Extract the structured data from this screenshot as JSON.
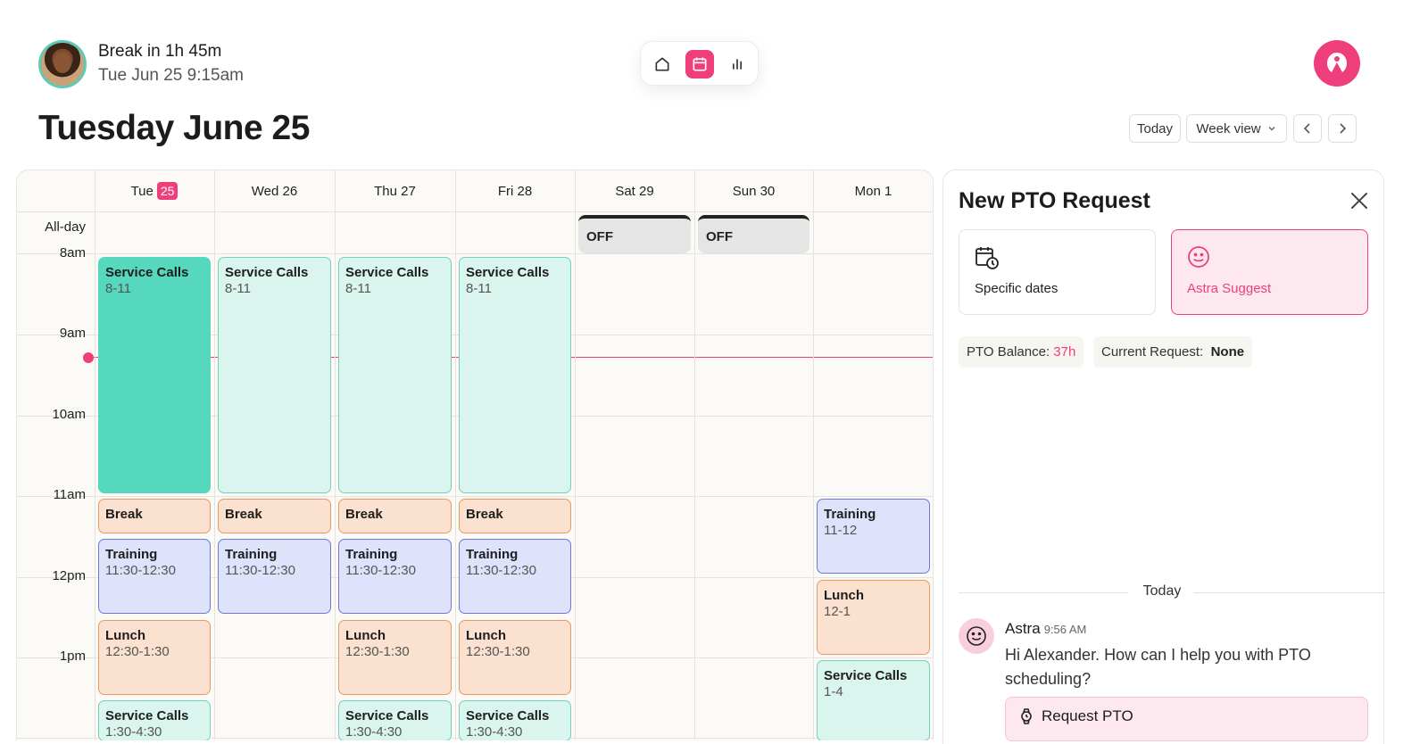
{
  "header": {
    "break_title": "Break in 1h 45m",
    "break_datetime": "Tue Jun 25 9:15am",
    "nav": {
      "home_icon": "home-icon",
      "calendar_icon": "calendar-icon",
      "stats_icon": "bar-chart-icon",
      "active": "calendar"
    },
    "brand_icon": "astra-logo-icon"
  },
  "page_title": "Tuesday June 25",
  "controls": {
    "today_label": "Today",
    "view_label": "Week view",
    "prev_icon": "chevron-left-icon",
    "next_icon": "chevron-right-icon"
  },
  "calendar": {
    "days": [
      {
        "label": "Tue",
        "badge": "25"
      },
      {
        "label": "Wed 26",
        "badge": ""
      },
      {
        "label": "Thu 27",
        "badge": ""
      },
      {
        "label": "Fri 28",
        "badge": ""
      },
      {
        "label": "Sat 29",
        "badge": ""
      },
      {
        "label": "Sun 30",
        "badge": ""
      },
      {
        "label": "Mon 1",
        "badge": ""
      }
    ],
    "allday_label": "All-day",
    "allday_events": [
      {
        "day": 4,
        "label": "OFF"
      },
      {
        "day": 5,
        "label": "OFF"
      }
    ],
    "hours": [
      "8am",
      "9am",
      "10am",
      "11am",
      "12pm",
      "1pm"
    ],
    "now_time": "9:15am",
    "events": [
      {
        "day": 0,
        "title": "Service Calls",
        "time": "8-11",
        "kind": "service-active"
      },
      {
        "day": 1,
        "title": "Service Calls",
        "time": "8-11",
        "kind": "service"
      },
      {
        "day": 2,
        "title": "Service Calls",
        "time": "8-11",
        "kind": "service"
      },
      {
        "day": 3,
        "title": "Service Calls",
        "time": "8-11",
        "kind": "service"
      },
      {
        "day": 0,
        "title": "Break",
        "time": "",
        "kind": "break"
      },
      {
        "day": 1,
        "title": "Break",
        "time": "",
        "kind": "break"
      },
      {
        "day": 2,
        "title": "Break",
        "time": "",
        "kind": "break"
      },
      {
        "day": 3,
        "title": "Break",
        "time": "",
        "kind": "break"
      },
      {
        "day": 0,
        "title": "Training",
        "time": "11:30-12:30",
        "kind": "training"
      },
      {
        "day": 1,
        "title": "Training",
        "time": "11:30-12:30",
        "kind": "training"
      },
      {
        "day": 2,
        "title": "Training",
        "time": "11:30-12:30",
        "kind": "training"
      },
      {
        "day": 3,
        "title": "Training",
        "time": "11:30-12:30",
        "kind": "training"
      },
      {
        "day": 6,
        "title": "Training",
        "time": "11-12",
        "kind": "training"
      },
      {
        "day": 0,
        "title": "Lunch",
        "time": "12:30-1:30",
        "kind": "lunch"
      },
      {
        "day": 2,
        "title": "Lunch",
        "time": "12:30-1:30",
        "kind": "lunch"
      },
      {
        "day": 3,
        "title": "Lunch",
        "time": "12:30-1:30",
        "kind": "lunch"
      },
      {
        "day": 6,
        "title": "Lunch",
        "time": "12-1",
        "kind": "lunch"
      },
      {
        "day": 0,
        "title": "Service Calls",
        "time": "1:30-4:30",
        "kind": "service"
      },
      {
        "day": 2,
        "title": "Service Calls",
        "time": "1:30-4:30",
        "kind": "service"
      },
      {
        "day": 3,
        "title": "Service Calls",
        "time": "1:30-4:30",
        "kind": "service"
      },
      {
        "day": 6,
        "title": "Service Calls",
        "time": "1-4",
        "kind": "service"
      }
    ]
  },
  "pto_panel": {
    "title": "New PTO Request",
    "close_icon": "close-icon",
    "options": [
      {
        "label": "Specific dates",
        "icon": "calendar-clock-icon",
        "selected": false
      },
      {
        "label": "Astra Suggest",
        "icon": "smiley-icon",
        "selected": true
      }
    ],
    "balance_label": "PTO Balance:",
    "balance_value": "37h",
    "current_label": "Current Request:",
    "current_value": "None",
    "divider_label": "Today",
    "message": {
      "sender": "Astra",
      "time": "9:56 AM",
      "text": "Hi Alexander. How can I help you with PTO scheduling?"
    },
    "request_button": {
      "label": "Request PTO",
      "icon": "watch-icon"
    }
  },
  "colors": {
    "accent": "#ee3f7c",
    "service": "#d9f5ee",
    "service_active": "#56d8be",
    "break": "#fbe1cf",
    "training": "#dfe2fb",
    "lunch": "#fbe1cf"
  }
}
